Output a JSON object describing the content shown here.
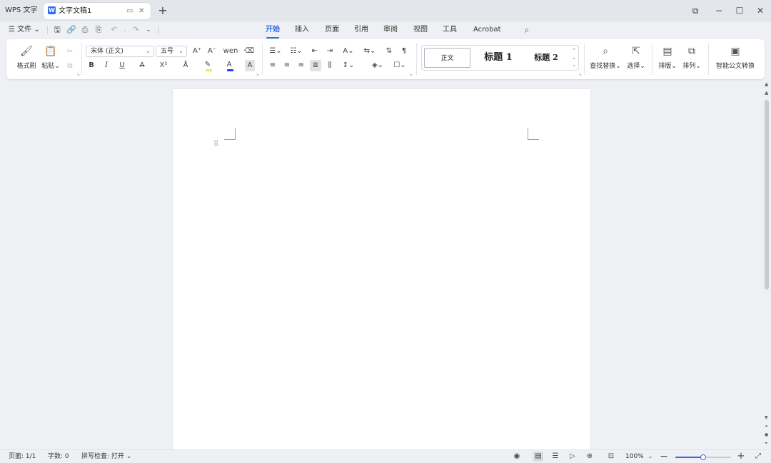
{
  "titlebar": {
    "app_name": "WPS 文字",
    "document_tab": "文字文稿1",
    "new_tab_glyph": "+",
    "window_controls": {
      "restore": "⧉",
      "minimize": "−",
      "maximize": "☐",
      "close": "✕"
    }
  },
  "menubar": {
    "file_menu": "☰ 文件 ⌄",
    "tabs": [
      "开始",
      "插入",
      "页面",
      "引用",
      "审阅",
      "视图",
      "工具",
      "Acrobat"
    ],
    "active_tab": "开始"
  },
  "ribbon": {
    "clipboard": {
      "format_painter": "格式刷",
      "paste": "粘贴⌄"
    },
    "font": {
      "font_name": "宋体 (正文)",
      "font_size": "五号",
      "bold": "B",
      "italic": "I",
      "underline": "U",
      "strikethrough": "A",
      "superscript": "X²",
      "increase_size": "A⁺",
      "decrease_size": "A⁻",
      "pinyin": "wen",
      "clear": "⌫",
      "highlight_color": "#f5e94a",
      "font_color": "#1f3cff"
    },
    "styles": {
      "normal": "正文",
      "heading1": "标题 1",
      "heading2": "标题 2"
    },
    "find_replace": "查找替换⌄",
    "select": "选择⌄",
    "layout": "排版⌄",
    "arrange": "排列⌄",
    "convert": "智能公文转换"
  },
  "statusbar": {
    "page": "页面: 1/1",
    "words": "字数: 0",
    "spellcheck": "拼写检查: 打开 ⌄",
    "zoom": "100%",
    "zoom_fraction": 0.5
  }
}
